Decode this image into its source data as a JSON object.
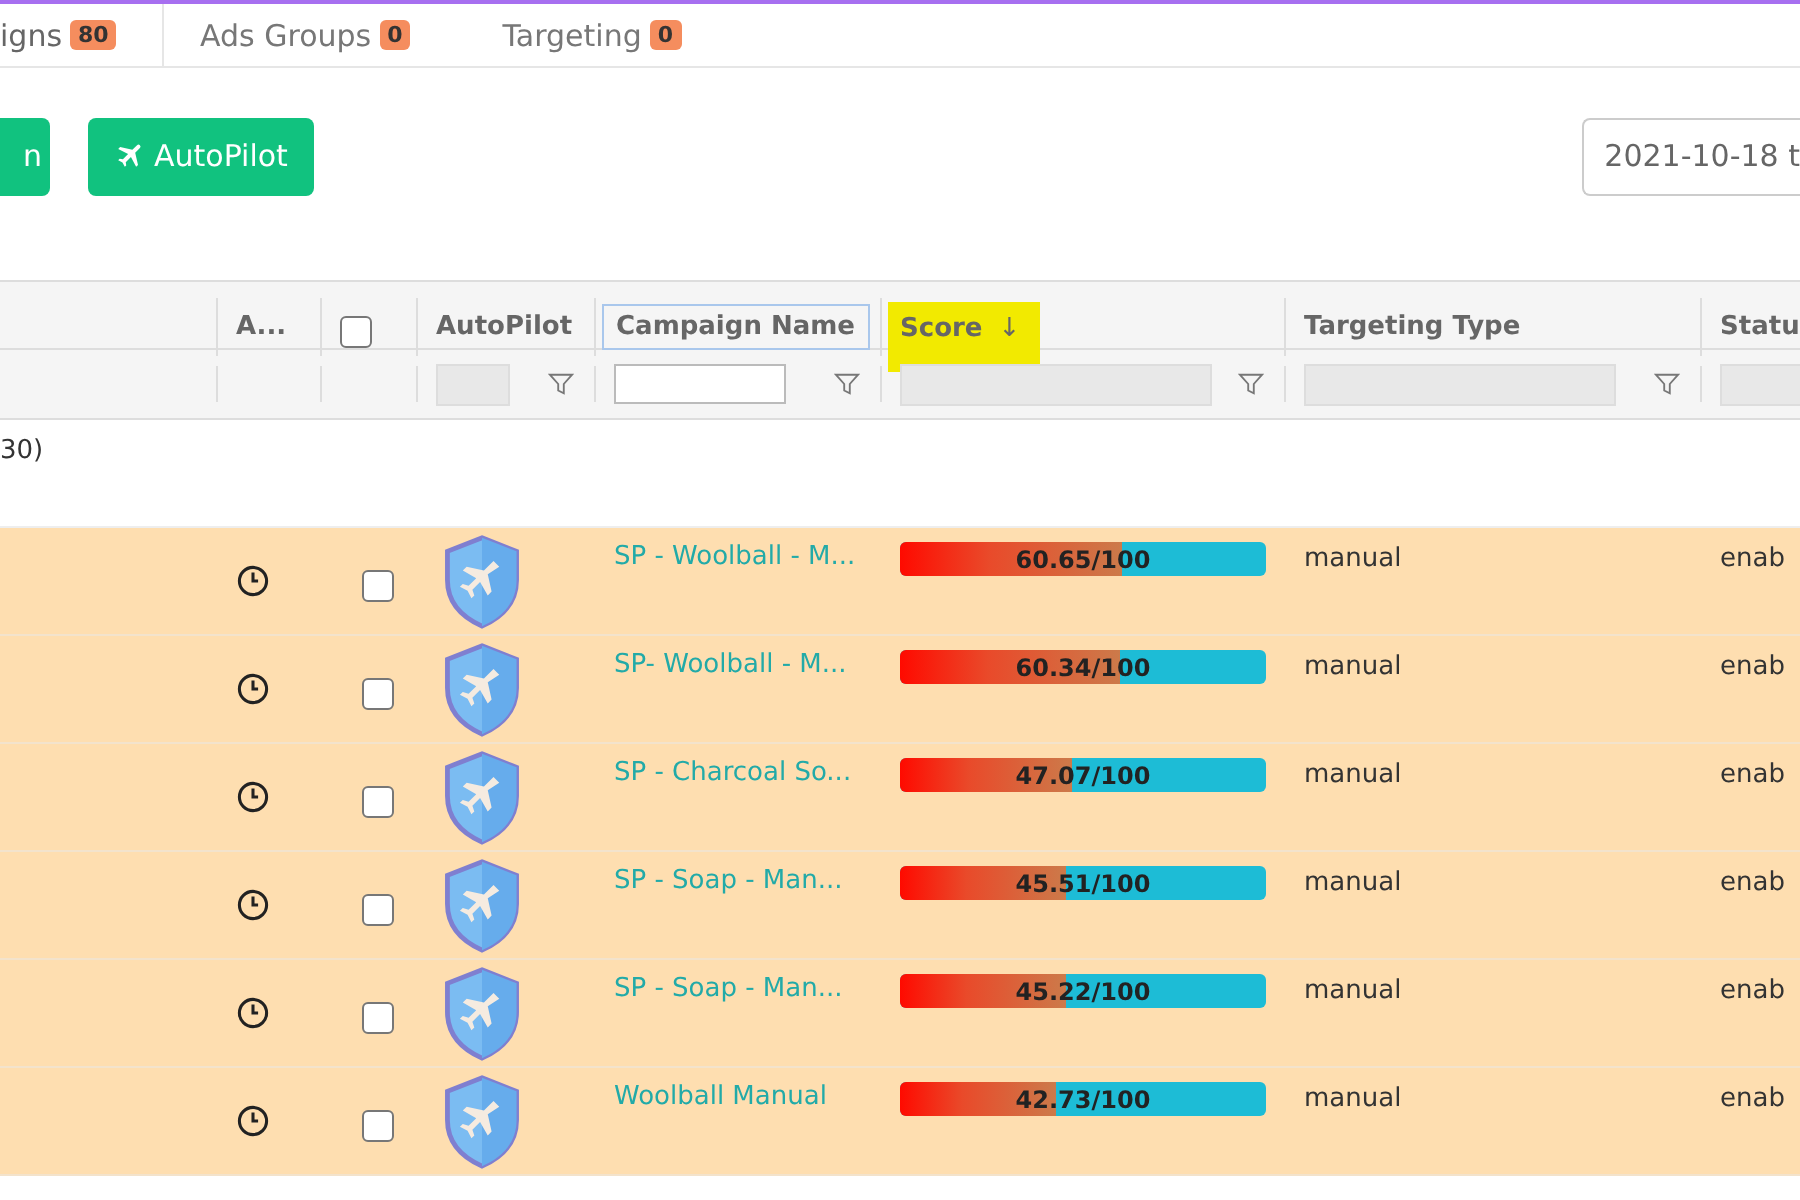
{
  "tabs": [
    {
      "label": "igns",
      "count": "80",
      "selected": true
    },
    {
      "label": "Ads Groups",
      "count": "0",
      "selected": false
    },
    {
      "label": "Targeting",
      "count": "0",
      "selected": false
    }
  ],
  "toolbar": {
    "buttons": [
      {
        "label": "n",
        "kind": "plain"
      },
      {
        "label": "AutoPilot",
        "kind": "autopilot"
      }
    ],
    "date_range": "2021-10-18 t"
  },
  "table": {
    "columns": [
      {
        "kind": "blank"
      },
      {
        "label": "A...",
        "kind": "text"
      },
      {
        "kind": "checkbox",
        "checked": false
      },
      {
        "label": "AutoPilot",
        "kind": "text"
      },
      {
        "label": "Campaign Name",
        "kind": "text",
        "focused": true
      },
      {
        "label": "Score",
        "kind": "text",
        "sort": "↓",
        "highlighted": true
      },
      {
        "label": "Targeting Type",
        "kind": "text"
      },
      {
        "label": "Statu",
        "kind": "text"
      }
    ],
    "filters": [
      {
        "kind": "none"
      },
      {
        "kind": "none"
      },
      {
        "kind": "none"
      },
      {
        "kind": "disabled"
      },
      {
        "kind": "input"
      },
      {
        "kind": "disabled"
      },
      {
        "kind": "disabled"
      },
      {
        "kind": "disabled"
      }
    ],
    "group_label": "30)",
    "rows": [
      {
        "checked": false,
        "campaign_name": "SP - Woolball - M...",
        "score": "60.65/100",
        "level": 0.6065,
        "targeting_type": "manual",
        "status": "enab"
      },
      {
        "checked": false,
        "campaign_name": "SP- Woolball - M...",
        "score": "60.34/100",
        "level": 0.6034,
        "targeting_type": "manual",
        "status": "enab"
      },
      {
        "checked": false,
        "campaign_name": "SP - Charcoal So...",
        "score": "47.07/100",
        "level": 0.4707,
        "targeting_type": "manual",
        "status": "enab"
      },
      {
        "checked": false,
        "campaign_name": "SP - Soap - Man...",
        "score": "45.51/100",
        "level": 0.4551,
        "targeting_type": "manual",
        "status": "enab"
      },
      {
        "checked": false,
        "campaign_name": "SP - Soap - Man...",
        "score": "45.22/100",
        "level": 0.4522,
        "targeting_type": "manual",
        "status": "enab"
      },
      {
        "checked": false,
        "campaign_name": "Woolball Manual",
        "score": "42.73/100",
        "level": 0.4273,
        "targeting_type": "manual",
        "status": "enab"
      }
    ]
  }
}
